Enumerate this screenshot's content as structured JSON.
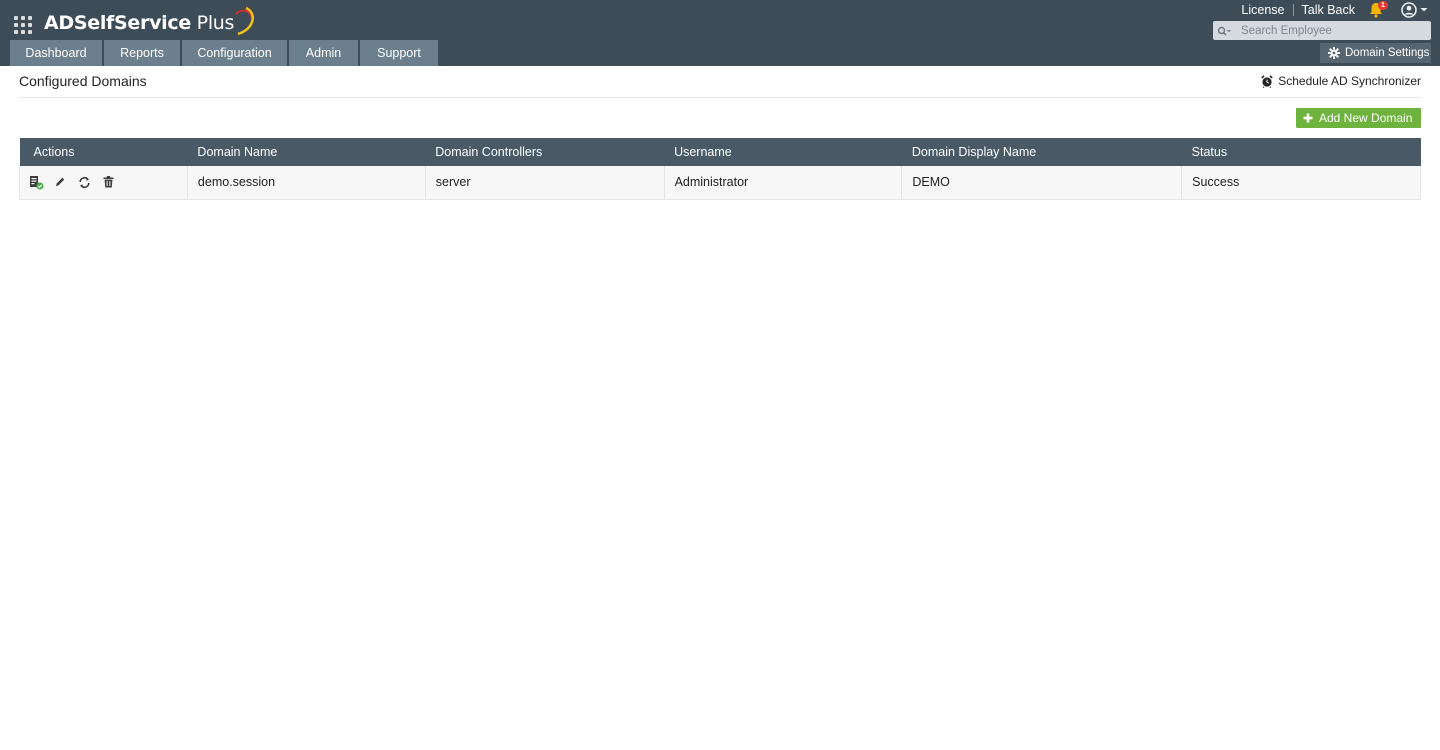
{
  "app": {
    "logo_part1": "ADSelfService",
    "logo_part2": " Plus"
  },
  "top_links": {
    "license": "License",
    "talk_back": "Talk Back",
    "notification_count": "1"
  },
  "search": {
    "placeholder": "Search Employee",
    "value": ""
  },
  "domain_settings_label": "Domain Settings",
  "nav": {
    "tabs": [
      {
        "label": "Dashboard"
      },
      {
        "label": "Reports"
      },
      {
        "label": "Configuration"
      },
      {
        "label": "Admin"
      },
      {
        "label": "Support"
      }
    ]
  },
  "page": {
    "title": "Configured Domains",
    "schedule_label": "Schedule AD Synchronizer",
    "add_button_label": "Add New Domain"
  },
  "table": {
    "columns": [
      "Actions",
      "Domain Name",
      "Domain Controllers",
      "Username",
      "Domain Display Name",
      "Status"
    ],
    "rows": [
      {
        "domain_name": "demo.session",
        "domain_controllers": "server",
        "username": "Administrator",
        "display_name": "DEMO",
        "status": "Success"
      }
    ]
  },
  "icons": {
    "apps": "apps-grid-icon",
    "bell": "bell-icon",
    "user": "user-circle-icon",
    "search": "search-icon",
    "gear": "gear-icon",
    "alarm": "alarm-clock-icon",
    "plus": "plus-icon",
    "row_actions": [
      "domain-details-icon",
      "edit-icon",
      "sync-icon",
      "delete-icon"
    ]
  },
  "colors": {
    "header_bg": "#3e4c57",
    "nav_tab_bg": "#6c7f8c",
    "table_header_bg": "#4a5966",
    "add_button_bg": "#6fb33f",
    "badge": "#e53935"
  }
}
